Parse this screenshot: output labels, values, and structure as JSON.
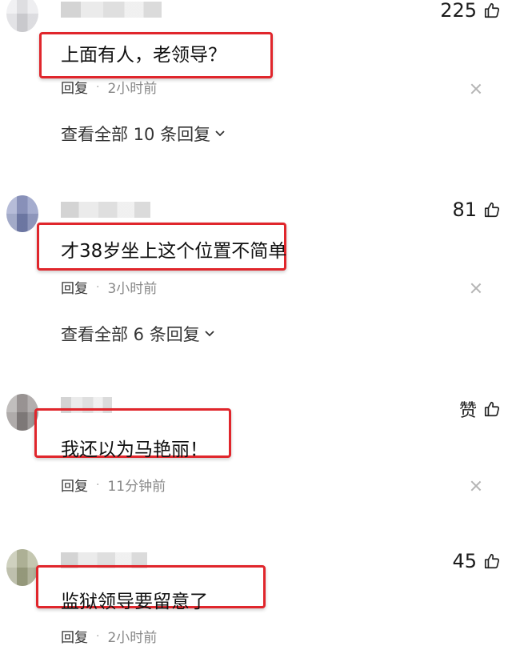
{
  "comments": [
    {
      "likes": "225",
      "text": "上面有人，老领导？",
      "reply_label": "回复",
      "separator": "·",
      "time": "2小时前",
      "expand_label": "查看全部 10 条回复",
      "avatar_color": "#e6e6ea"
    },
    {
      "likes": "81",
      "text": "才38岁坐上这个位置不简单",
      "reply_label": "回复",
      "separator": "·",
      "time": "3小时前",
      "expand_label": "查看全部 6 条回复",
      "avatar_color": "#7b86b8"
    },
    {
      "likes": "赞",
      "text": "我还以为马艳丽！",
      "reply_label": "回复",
      "separator": "·",
      "time": "11分钟前",
      "expand_label": "",
      "avatar_color": "#8f8988"
    },
    {
      "likes": "45",
      "text": "监狱领导要留意了",
      "reply_label": "回复",
      "separator": "·",
      "time": "2小时前",
      "expand_label": "",
      "avatar_color": "#a9ad8c"
    }
  ],
  "accent_color": "#e0262c",
  "icons": [
    "thumbs-up-icon",
    "close-icon",
    "chevron-down-icon"
  ]
}
